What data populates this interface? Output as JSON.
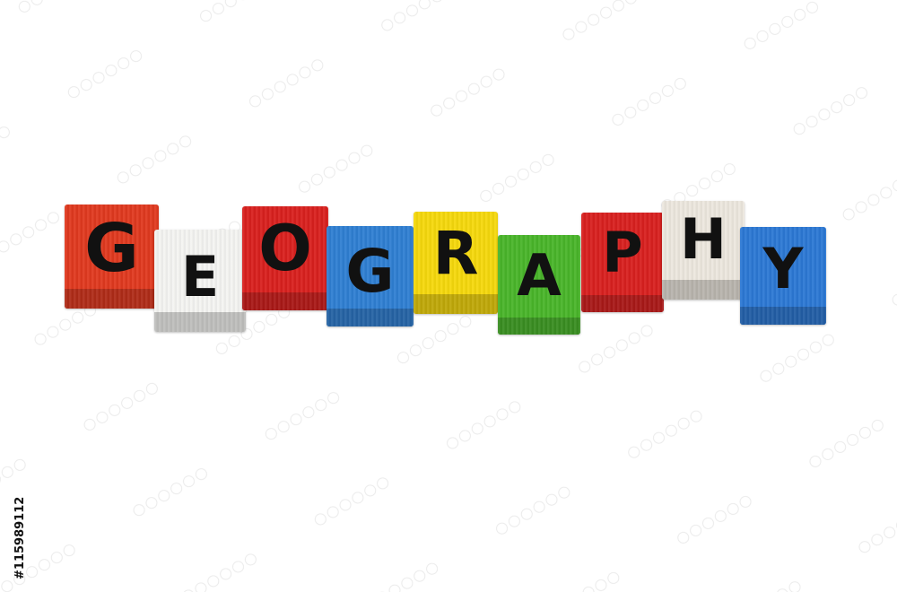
{
  "word": "GEOGRAPHY",
  "blocks": [
    {
      "letter": "G",
      "color": "#e0391f"
    },
    {
      "letter": "E",
      "color": "#f4f4f1"
    },
    {
      "letter": "O",
      "color": "#d9201e"
    },
    {
      "letter": "G",
      "color": "#2f7fd2"
    },
    {
      "letter": "R",
      "color": "#f5d80c"
    },
    {
      "letter": "A",
      "color": "#49b52a"
    },
    {
      "letter": "P",
      "color": "#d8201f"
    },
    {
      "letter": "H",
      "color": "#ece7de"
    },
    {
      "letter": "Y",
      "color": "#2c78d4"
    }
  ],
  "stock_id": "#115989112",
  "background_color": "#ffffff"
}
